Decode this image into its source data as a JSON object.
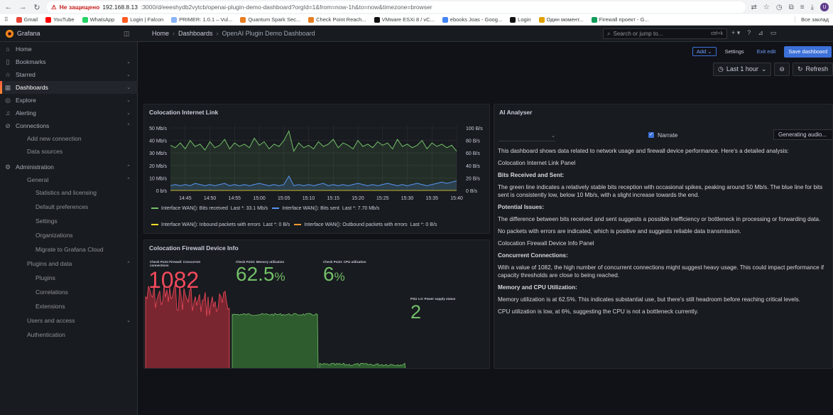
{
  "browser": {
    "security_label": "Не защищено",
    "url_host": "192.168.8.13",
    "url_path": ":3000/d/eeeshydb2vytcb/openai-plugin-demo-dashboard?orgId=1&from=now-1h&to=now&timezone=browser",
    "avatar_letter": "U",
    "bookmarks": [
      "Gmail",
      "YouTube",
      "WhatsApp",
      "Login | Falcon",
      "PRIMER: 1.0.1 – Vul...",
      "Quantum Spark Sec...",
      "Check Point Reach...",
      "VMware ESXi 8 / vC...",
      "ebooks Joas - Goog...",
      "Login",
      "Один момент...",
      "Firewall проект - G..."
    ],
    "bookmarks_all": "Все заклад"
  },
  "header": {
    "brand": "Grafana",
    "crumbs": [
      "Home",
      "Dashboards",
      "OpenAI Plugin Demo Dashboard"
    ],
    "search_placeholder": "Search or jump to...",
    "search_kbd": "ctrl+k"
  },
  "toolbar": {
    "add_label": "Add",
    "settings_label": "Settings",
    "exit_label": "Exit edit",
    "save_label": "Save dashboard",
    "time_label": "Last 1 hour",
    "refresh_label": "Refresh"
  },
  "sidebar": {
    "items": [
      {
        "label": "Home",
        "icon": "home-icon",
        "glyph": "⌂"
      },
      {
        "label": "Bookmarks",
        "icon": "bookmark-icon",
        "glyph": "▯"
      },
      {
        "label": "Starred",
        "icon": "star-icon",
        "glyph": "☆"
      },
      {
        "label": "Dashboards",
        "icon": "dashboards-icon",
        "glyph": "▦"
      },
      {
        "label": "Explore",
        "icon": "explore-icon",
        "glyph": "◎"
      },
      {
        "label": "Alerting",
        "icon": "bell-icon",
        "glyph": "♫"
      },
      {
        "label": "Connections",
        "icon": "connections-icon",
        "glyph": "⊘"
      },
      {
        "label": "Add new connection"
      },
      {
        "label": "Data sources"
      },
      {
        "label": "Administration",
        "icon": "gear-icon",
        "glyph": "⚙"
      },
      {
        "label": "General"
      },
      {
        "label": "Statistics and licensing"
      },
      {
        "label": "Default preferences"
      },
      {
        "label": "Settings"
      },
      {
        "label": "Organizations"
      },
      {
        "label": "Migrate to Grafana Cloud"
      },
      {
        "label": "Plugins and data"
      },
      {
        "label": "Plugins"
      },
      {
        "label": "Correlations"
      },
      {
        "label": "Extensions"
      },
      {
        "label": "Users and access"
      },
      {
        "label": "Authentication"
      }
    ]
  },
  "link_panel": {
    "title": "Colocation Internet Link",
    "left_ticks": [
      "50 Mb/s",
      "40 Mb/s",
      "30 Mb/s",
      "20 Mb/s",
      "10 Mb/s",
      "0 b/s"
    ],
    "right_ticks": [
      "100 B/s",
      "80 B/s",
      "60 B/s",
      "40 B/s",
      "20 B/s",
      "0 B/s"
    ],
    "x_ticks": [
      "14:45",
      "14:50",
      "14:55",
      "15:00",
      "15:05",
      "15:10",
      "15:15",
      "15:20",
      "15:25",
      "15:30",
      "15:35",
      "15:40"
    ],
    "legend": [
      {
        "name": "Interface WAN(): Bits received",
        "last": "Last *: 33.1 Mb/s",
        "color": "#73bf69"
      },
      {
        "name": "Interface WAN(): Bits sent",
        "last": "Last *: 7.70 Mb/s",
        "color": "#5794f2"
      },
      {
        "name": "Interface WAN(): Inbound packets with errors",
        "last": "Last *: 0 B/s",
        "color": "#fade2a"
      },
      {
        "name": "Interface WAN(): Outbound packets with errors",
        "last": "Last *: 0 B/s",
        "color": "#ff9830"
      }
    ]
  },
  "chart_data": {
    "type": "line",
    "x": [
      "14:42",
      "14:43",
      "14:44",
      "14:45",
      "14:46",
      "14:47",
      "14:48",
      "14:49",
      "14:50",
      "14:51",
      "14:52",
      "14:53",
      "14:54",
      "14:55",
      "14:56",
      "14:57",
      "14:58",
      "14:59",
      "15:00",
      "15:01",
      "15:02",
      "15:03",
      "15:04",
      "15:05",
      "15:06",
      "15:07",
      "15:08",
      "15:09",
      "15:10",
      "15:11",
      "15:12",
      "15:13",
      "15:14",
      "15:15",
      "15:16",
      "15:17",
      "15:18",
      "15:19",
      "15:20",
      "15:21",
      "15:22",
      "15:23",
      "15:24",
      "15:25",
      "15:26",
      "15:27",
      "15:28",
      "15:29",
      "15:30",
      "15:31",
      "15:32",
      "15:33",
      "15:34",
      "15:35",
      "15:36",
      "15:37",
      "15:38",
      "15:39",
      "15:40"
    ],
    "ylim": [
      0,
      55
    ],
    "series": [
      {
        "name": "Interface WAN(): Bits received",
        "color": "#73bf69",
        "values": [
          38,
          36,
          40,
          35,
          42,
          37,
          39,
          34,
          41,
          36,
          38,
          43,
          35,
          40,
          37,
          39,
          36,
          44,
          38,
          41,
          35,
          39,
          37,
          42,
          50,
          33,
          40,
          36,
          38,
          35,
          41,
          37,
          39,
          43,
          36,
          40,
          38,
          35,
          42,
          37,
          39,
          36,
          41,
          38,
          40,
          35,
          43,
          37,
          39,
          36,
          38,
          42,
          35,
          40,
          37,
          39,
          36,
          38,
          33
        ]
      },
      {
        "name": "Interface WAN(): Bits sent",
        "color": "#5794f2",
        "values": [
          4,
          5,
          4,
          5,
          4,
          6,
          5,
          4,
          5,
          4,
          5,
          6,
          4,
          5,
          4,
          5,
          4,
          5,
          6,
          5,
          4,
          5,
          4,
          5,
          12,
          4,
          5,
          4,
          5,
          4,
          5,
          6,
          4,
          5,
          4,
          5,
          4,
          5,
          6,
          5,
          4,
          5,
          4,
          5,
          6,
          5,
          4,
          5,
          4,
          5,
          6,
          5,
          4,
          5,
          6,
          7,
          6,
          7,
          8
        ]
      }
    ]
  },
  "fw_panel": {
    "title": "Colocation Firewall Device Info",
    "conn_label": "Check Point Firewall: Concurrent connections",
    "conn_value": "1082",
    "mem_label": "Check Point: Memory utilization",
    "mem_value": "62.5",
    "mem_unit": "%",
    "cpu_label": "Check Point: CPU utilization",
    "cpu_value": "6",
    "cpu_unit": "%",
    "psu_label": "PSU 1.0: Power supply status",
    "psu_value": "2"
  },
  "ai_panel": {
    "title": "AI Analyser",
    "narrate_label": "Narrate",
    "generating_label": "Generating audio...",
    "paragraphs": [
      "This dashboard shows data related to network usage and firewall device performance. Here's a detailed analysis:",
      "Colocation Internet Link Panel",
      "Bits Received and Sent:",
      "The green line indicates a relatively stable bits reception with occasional spikes, peaking around 50 Mb/s. The blue line for bits sent is consistently low, below 10 Mb/s, with a slight increase towards the end.",
      "Potential Issues:",
      "The difference between bits received and sent suggests a possible inefficiency or bottleneck in processing or forwarding data.",
      "No packets with errors are indicated, which is positive and suggests reliable data transmission.",
      "Colocation Firewall Device Info Panel",
      "Concurrent Connections:",
      "With a value of 1082, the high number of concurrent connections might suggest heavy usage. This could impact performance if capacity thresholds are close to being reached.",
      "Memory and CPU Utilization:",
      "Memory utilization is at 62.5%. This indicates substantial use, but there's still headroom before reaching critical levels.",
      "CPU utilization is low, at 6%, suggesting the CPU is not a bottleneck currently."
    ]
  }
}
